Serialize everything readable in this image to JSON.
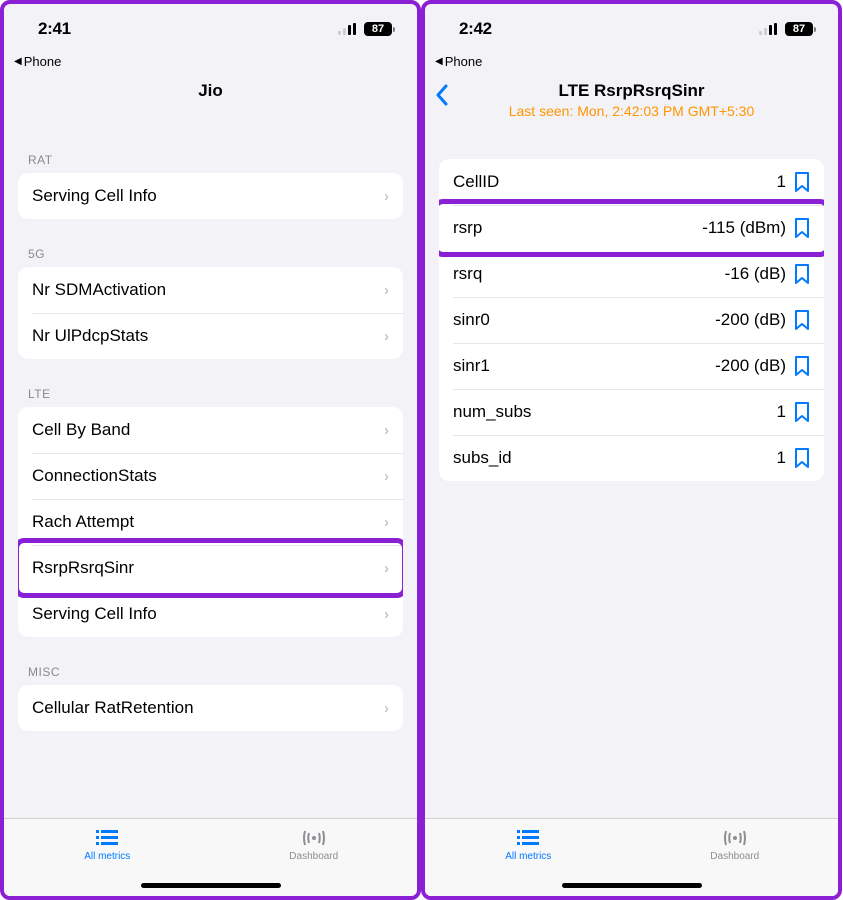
{
  "left": {
    "status": {
      "time": "2:41",
      "battery": "87"
    },
    "breadcrumb": "Phone",
    "header": {
      "title": "Jio"
    },
    "sections": [
      {
        "title": "RAT",
        "rows": [
          {
            "label": "Serving Cell Info"
          }
        ]
      },
      {
        "title": "5G",
        "rows": [
          {
            "label": "Nr SDMActivation"
          },
          {
            "label": "Nr UlPdcpStats"
          }
        ]
      },
      {
        "title": "LTE",
        "rows": [
          {
            "label": "Cell By Band"
          },
          {
            "label": "ConnectionStats"
          },
          {
            "label": "Rach Attempt"
          },
          {
            "label": "RsrpRsrqSinr",
            "highlighted": true
          },
          {
            "label": "Serving Cell Info"
          }
        ]
      },
      {
        "title": "MISC",
        "rows": [
          {
            "label": "Cellular RatRetention"
          }
        ]
      }
    ],
    "tabs": {
      "all": "All metrics",
      "dashboard": "Dashboard"
    }
  },
  "right": {
    "status": {
      "time": "2:42",
      "battery": "87"
    },
    "breadcrumb": "Phone",
    "header": {
      "title": "LTE RsrpRsrqSinr",
      "sub": "Last seen: Mon, 2:42:03 PM GMT+5:30"
    },
    "rows": [
      {
        "label": "CellID",
        "value": "1"
      },
      {
        "label": "rsrp",
        "value": "-115 (dBm)",
        "highlighted": true
      },
      {
        "label": "rsrq",
        "value": "-16 (dB)"
      },
      {
        "label": "sinr0",
        "value": "-200 (dB)"
      },
      {
        "label": "sinr1",
        "value": "-200 (dB)"
      },
      {
        "label": "num_subs",
        "value": "1"
      },
      {
        "label": "subs_id",
        "value": "1"
      }
    ],
    "tabs": {
      "all": "All metrics",
      "dashboard": "Dashboard"
    }
  }
}
